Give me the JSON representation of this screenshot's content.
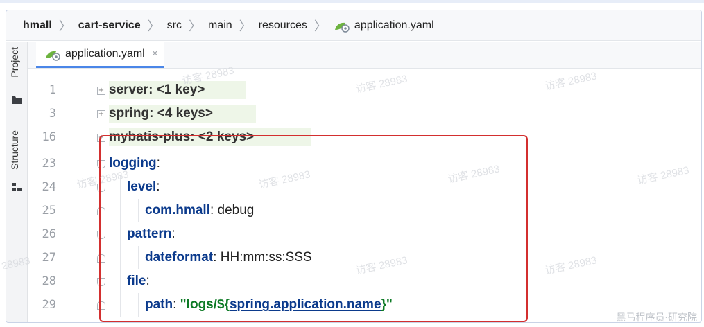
{
  "breadcrumb": {
    "items": [
      {
        "label": "hmall",
        "bold": true
      },
      {
        "label": "cart-service",
        "bold": true
      },
      {
        "label": "src",
        "bold": false
      },
      {
        "label": "main",
        "bold": false
      },
      {
        "label": "resources",
        "bold": false
      },
      {
        "label": "application.yaml",
        "bold": false,
        "icon": "spring-leaf-icon"
      }
    ]
  },
  "sidebar": {
    "project_label": "Project",
    "structure_label": "Structure"
  },
  "tabs": [
    {
      "label": "application.yaml",
      "icon": "spring-leaf-icon",
      "close": "×",
      "active": true
    }
  ],
  "editor": {
    "lines": [
      {
        "number": "1",
        "key": "server",
        "colon": ":",
        "value": " <1 key>",
        "collapsed": true
      },
      {
        "number": "3",
        "key": "spring",
        "colon": ":",
        "value": " <4 keys>",
        "collapsed": true
      },
      {
        "number": "16",
        "key": "mybatis-plus",
        "colon": ":",
        "value": " <2 keys>",
        "collapsed": true
      },
      {
        "number": "23",
        "key": "logging",
        "colon": ":",
        "value": ""
      },
      {
        "number": "24",
        "key": "level",
        "colon": ":",
        "value": ""
      },
      {
        "number": "25",
        "key": "com.hmall",
        "colon": ":",
        "value": " debug"
      },
      {
        "number": "26",
        "key": "pattern",
        "colon": ":",
        "value": ""
      },
      {
        "number": "27",
        "key": "dateformat",
        "colon": ":",
        "value": " HH:mm:ss:SSS"
      },
      {
        "number": "28",
        "key": "file",
        "colon": ":",
        "value": ""
      },
      {
        "number": "29",
        "key": "path",
        "colon": ":",
        "value_prefix": " \"logs/${",
        "value_link": "spring.application.name",
        "value_suffix": "}\""
      }
    ]
  },
  "watermarks": {
    "text": "访客 28983",
    "partial_left": "28983",
    "corner": "黑马程序员·研究院"
  },
  "colors": {
    "highlight_border": "#d32f2f",
    "key_blue": "#0b3a8c",
    "string_green": "#0d7a25",
    "collapsed_bg": "#eef6e8"
  }
}
